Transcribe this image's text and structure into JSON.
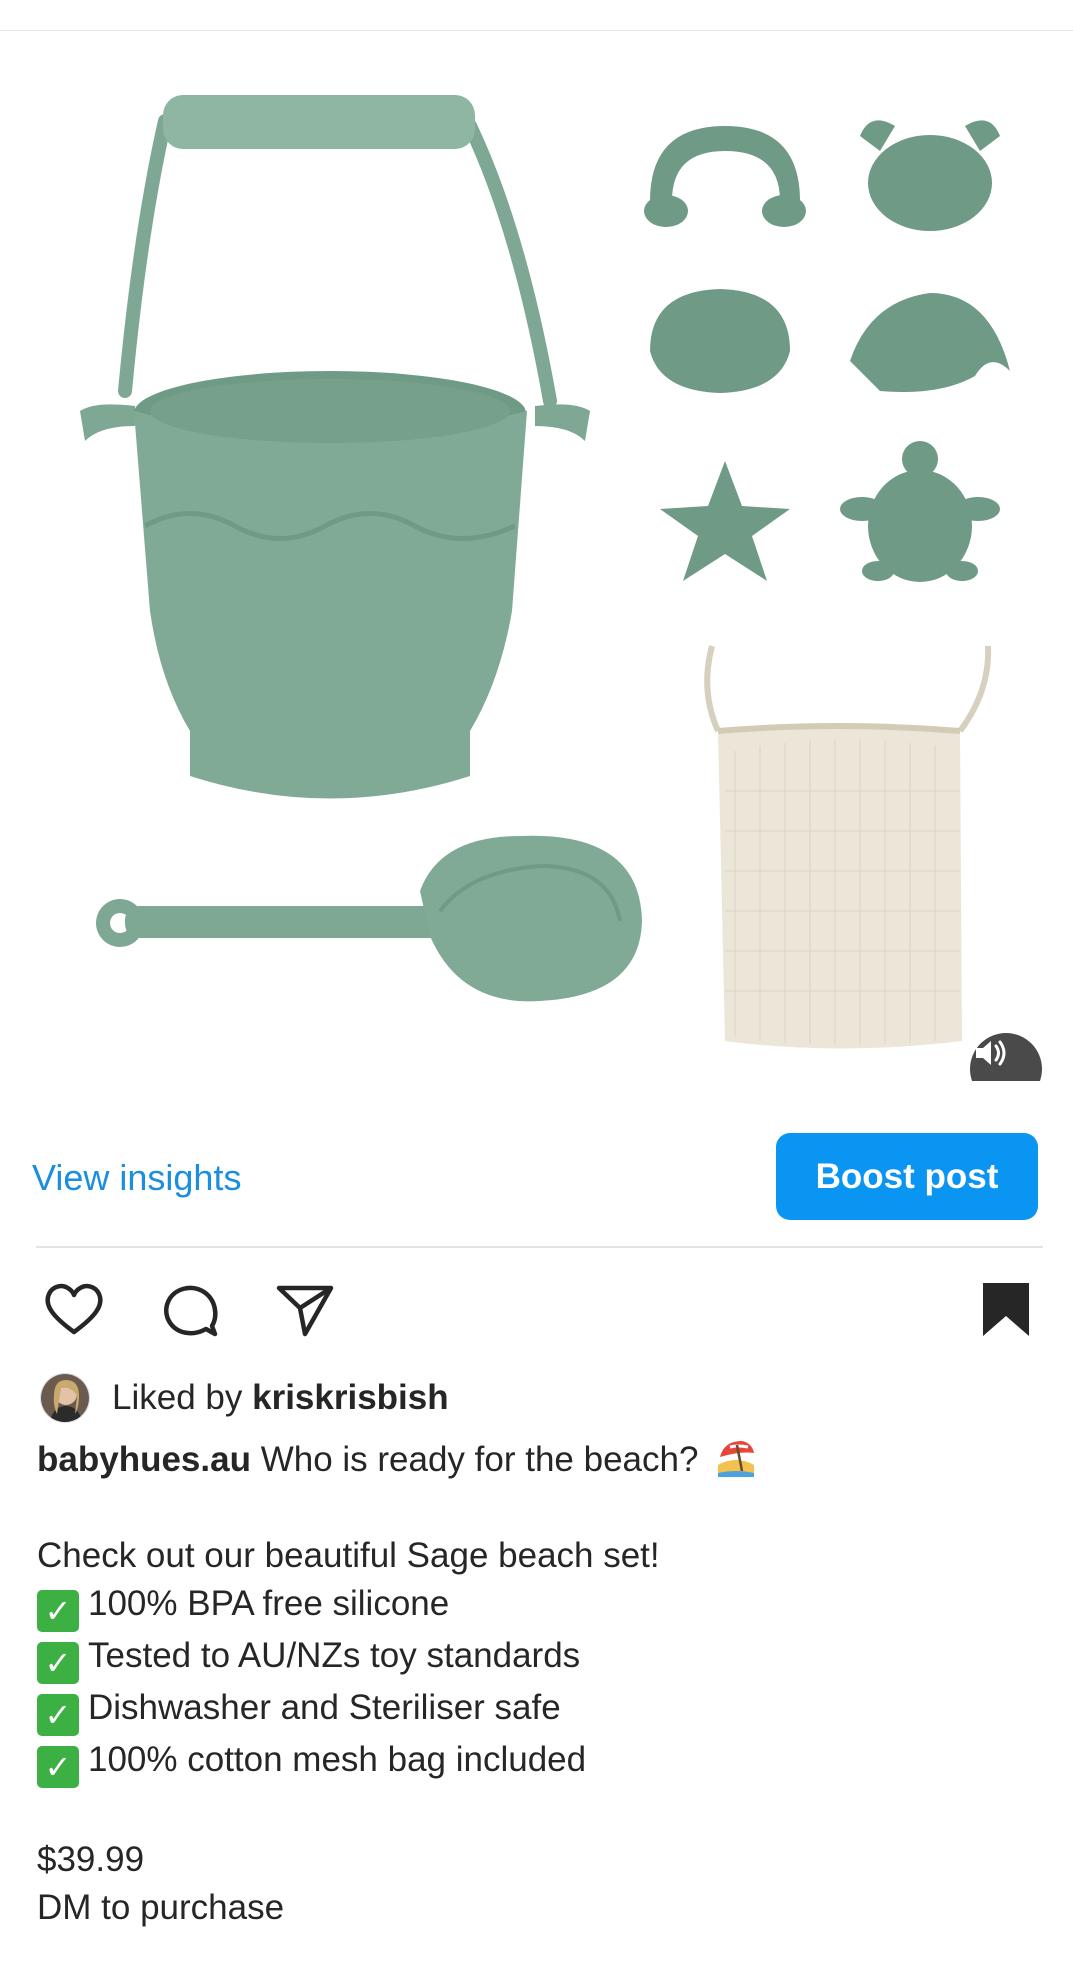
{
  "post": {
    "media": {
      "description_icon": "product-photo",
      "mute_icon": "speaker-mute-icon"
    },
    "insights": {
      "view_insights_label": "View insights",
      "boost_label": "Boost post"
    },
    "actions": {
      "like_icon": "heart-icon",
      "comment_icon": "comment-icon",
      "share_icon": "send-icon",
      "save_icon": "bookmark-icon"
    },
    "likes": {
      "prefix": "Liked by",
      "username": "kriskrisbish"
    },
    "caption": {
      "username": "babyhues.au",
      "first_line": "Who is ready for the beach?",
      "intro": "Check out our beautiful Sage beach set!",
      "features": [
        "100% BPA free silicone",
        "Tested to AU/NZs toy standards",
        "Dishwasher and Steriliser safe",
        "100% cotton mesh bag included"
      ],
      "price": "$39.99",
      "cta": "DM to purchase"
    }
  },
  "colors": {
    "accent": "#0a95f2",
    "link": "#1a8fe0",
    "sage": "#7fa894",
    "check": "#3cb043"
  }
}
